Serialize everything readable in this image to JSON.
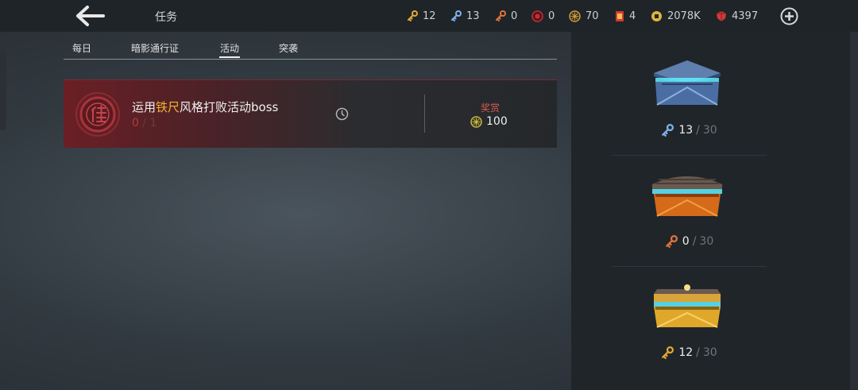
{
  "header": {
    "title": "任务",
    "resources": [
      {
        "icon": "gold-key-icon",
        "value": "12",
        "color": "#e3a72f"
      },
      {
        "icon": "blue-key-icon",
        "value": "13",
        "color": "#7fb3e8"
      },
      {
        "icon": "orange-key-icon",
        "value": "0",
        "color": "#e0733a"
      },
      {
        "icon": "red-token-icon",
        "value": "0",
        "color": "#c0303a"
      },
      {
        "icon": "bronze-coin-icon",
        "value": "70",
        "color": "#c89a4a"
      },
      {
        "icon": "red-ticket-icon",
        "value": "4",
        "color": "#d63a34"
      },
      {
        "icon": "gold-coin-icon",
        "value": "2078K",
        "color": "#e0b43a"
      },
      {
        "icon": "ruby-gem-icon",
        "value": "4397",
        "color": "#d23a3a"
      }
    ]
  },
  "tabs": [
    {
      "label": "每日",
      "active": false
    },
    {
      "label": "暗影通行证",
      "active": false
    },
    {
      "label": "活动",
      "active": true
    },
    {
      "label": "突袭",
      "active": false
    }
  ],
  "task": {
    "title_prefix": "运用",
    "title_highlight": "铁尺",
    "title_suffix": "风格打败活动boss",
    "progress_current": "0",
    "progress_sep": "/",
    "progress_total": "1",
    "reward_label": "奖赏",
    "reward_value": "100",
    "emblem_icon": "task-emblem-icon",
    "clock_icon": "clock-icon"
  },
  "chests": [
    {
      "name": "blue-chest",
      "current": "13",
      "sep": "/",
      "total": "30",
      "key_color": "#7fb3e8"
    },
    {
      "name": "orange-chest",
      "current": "0",
      "sep": "/",
      "total": "30",
      "key_color": "#e0733a"
    },
    {
      "name": "gold-chest",
      "current": "12",
      "sep": "/",
      "total": "30",
      "key_color": "#e3a72f"
    }
  ]
}
